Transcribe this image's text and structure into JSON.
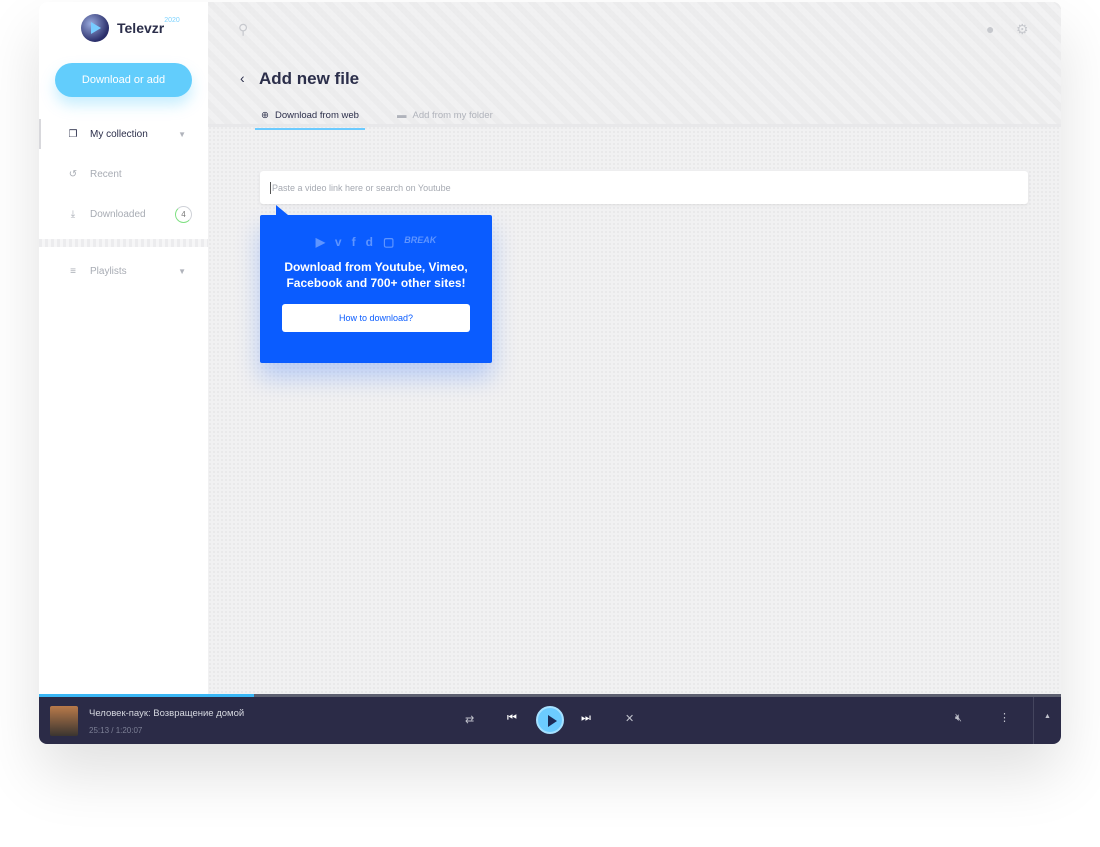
{
  "app": {
    "name": "Televzr",
    "year": "2020"
  },
  "sidebar": {
    "download_button": "Download or add",
    "items": [
      {
        "label": "My collection",
        "icon": "collection-icon"
      },
      {
        "label": "Recent",
        "icon": "history-icon"
      },
      {
        "label": "Downloaded",
        "icon": "download-icon",
        "badge": "4"
      },
      {
        "label": "Playlists",
        "icon": "playlist-icon"
      }
    ]
  },
  "header": {
    "title": "Add new file",
    "tabs": [
      {
        "label": "Download from web",
        "active": true
      },
      {
        "label": "Add from my folder",
        "active": false
      }
    ]
  },
  "search": {
    "placeholder": "Paste a video link here or search on Youtube"
  },
  "popup": {
    "text": "Download from Youtube, Vimeo, Facebook and 700+ other sites!",
    "button": "How to download?",
    "sites": [
      "youtube-icon",
      "vimeo-icon",
      "facebook-icon",
      "dailymotion-icon",
      "twitch-icon",
      "break-icon"
    ]
  },
  "player": {
    "title": "Человек-паук: Возвращение домой",
    "time": "25:13 / 1:20:07",
    "progress": 0.21
  },
  "colors": {
    "accent": "#0a5cff",
    "button": "#62cdfc",
    "player_bg": "#2b2b47"
  }
}
